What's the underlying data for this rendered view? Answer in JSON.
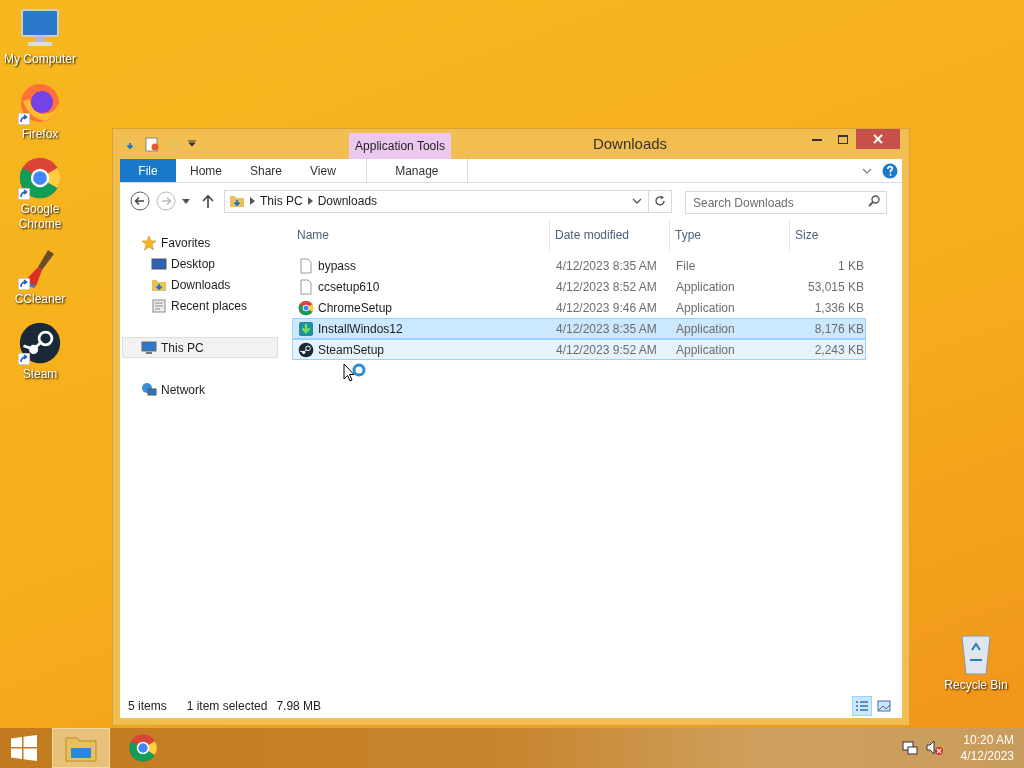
{
  "desktop_icons": [
    {
      "label": "My Computer",
      "kind": "computer"
    },
    {
      "label": "Firefox",
      "kind": "firefox"
    },
    {
      "label": "Google Chrome",
      "kind": "chrome"
    },
    {
      "label": "CCleaner",
      "kind": "ccleaner"
    },
    {
      "label": "Steam",
      "kind": "steam"
    }
  ],
  "recycle_bin": {
    "label": "Recycle Bin"
  },
  "window": {
    "title": "Downloads",
    "context_tab": "Application Tools",
    "tabs": [
      {
        "label": "File",
        "kind": "file"
      },
      {
        "label": "Home",
        "kind": "plain"
      },
      {
        "label": "Share",
        "kind": "plain"
      },
      {
        "label": "View",
        "kind": "plain"
      },
      {
        "label": "Manage",
        "kind": "context"
      }
    ],
    "address": {
      "path": [
        "This PC",
        "Downloads"
      ]
    },
    "search": {
      "placeholder": "Search Downloads"
    },
    "nav": [
      {
        "label": "Favorites",
        "kind": "star",
        "selected": false,
        "children": [
          {
            "label": "Desktop",
            "kind": "desktop",
            "selected": false
          },
          {
            "label": "Downloads",
            "kind": "downloads",
            "selected": false
          },
          {
            "label": "Recent places",
            "kind": "recent",
            "selected": false
          }
        ]
      },
      {
        "label": "This PC",
        "kind": "pc",
        "selected": true
      },
      {
        "label": "Network",
        "kind": "network",
        "selected": false
      }
    ],
    "columns": [
      "Name",
      "Date modified",
      "Type",
      "Size"
    ],
    "files": [
      {
        "name": "bypass",
        "date": "4/12/2023 8:35 AM",
        "type": "File",
        "size": "1 KB",
        "kind": "blank",
        "selected": false,
        "hovered": false
      },
      {
        "name": "ccsetup610",
        "date": "4/12/2023 8:52 AM",
        "type": "Application",
        "size": "53,015 KB",
        "kind": "blank",
        "selected": false,
        "hovered": false
      },
      {
        "name": "ChromeSetup",
        "date": "4/12/2023 9:46 AM",
        "type": "Application",
        "size": "1,336 KB",
        "kind": "chrome",
        "selected": false,
        "hovered": false
      },
      {
        "name": "InstallWindos12",
        "date": "4/12/2023 8:35 AM",
        "type": "Application",
        "size": "8,176 KB",
        "kind": "install",
        "selected": true,
        "hovered": false
      },
      {
        "name": "SteamSetup",
        "date": "4/12/2023 9:52 AM",
        "type": "Application",
        "size": "2,243 KB",
        "kind": "steam",
        "selected": false,
        "hovered": true
      }
    ],
    "status": {
      "count": "5 items",
      "selection": "1 item selected",
      "selection_size": "7.98 MB"
    },
    "views": [
      {
        "kind": "details",
        "selected": true
      },
      {
        "kind": "tiles",
        "selected": false
      }
    ]
  },
  "taskbar": {
    "apps": [
      {
        "kind": "explorer",
        "active": true
      },
      {
        "kind": "chrome",
        "active": false
      }
    ],
    "time": "10:20 AM",
    "date": "4/12/2023"
  }
}
